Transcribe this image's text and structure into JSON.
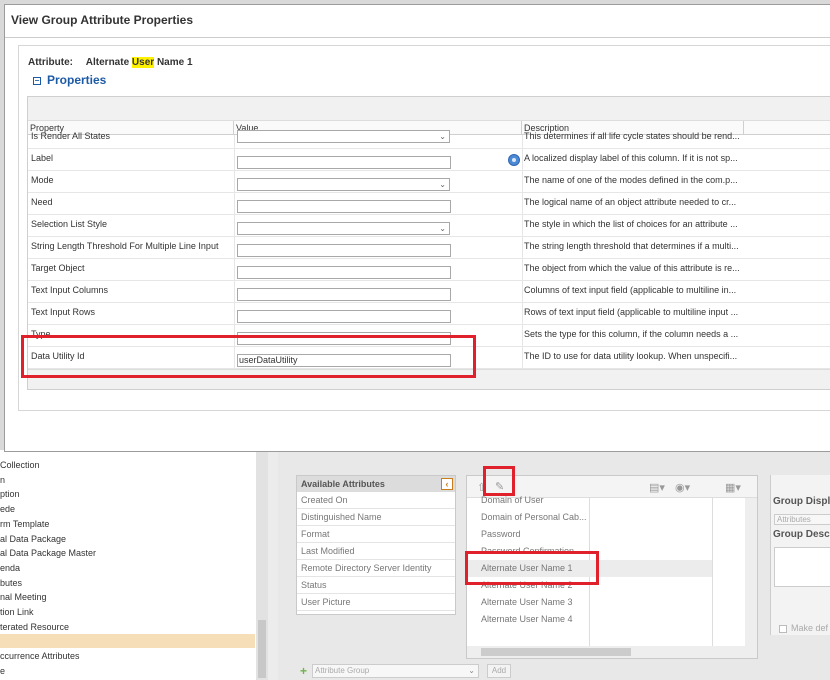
{
  "dialog": {
    "title": "View Group Attribute Properties",
    "attribute_label": "Attribute:",
    "attribute_value_prefix": "Alternate",
    "attribute_value_highlight": "User",
    "attribute_value_suffix": "Name 1",
    "section_title": "Properties"
  },
  "grid": {
    "columns": [
      "Property",
      "Value",
      "Description"
    ],
    "rows": [
      {
        "property": "Is Render All States",
        "control": "select",
        "value": "",
        "description": "This determines if all life cycle states should be rend..."
      },
      {
        "property": "Label",
        "control": "input",
        "value": "",
        "description": "A localized display label of this column. If it is not sp...",
        "icon": "localize-icon"
      },
      {
        "property": "Mode",
        "control": "select",
        "value": "",
        "description": "The name of one of the modes defined in the com.p..."
      },
      {
        "property": "Need",
        "control": "input",
        "value": "",
        "description": "The logical name of an object attribute needed to cr..."
      },
      {
        "property": "Selection List Style",
        "control": "select",
        "value": "",
        "description": "The style in which the list of choices for an attribute ..."
      },
      {
        "property": "String Length Threshold For Multiple Line Input",
        "control": "input",
        "value": "",
        "description": "The string length threshold that determines if a multi..."
      },
      {
        "property": "Target Object",
        "control": "input",
        "value": "",
        "description": "The object from which the value of this attribute is re..."
      },
      {
        "property": "Text Input Columns",
        "control": "input",
        "value": "",
        "description": "Columns of text input field (applicable to multiline in..."
      },
      {
        "property": "Text Input Rows",
        "control": "input",
        "value": "",
        "description": "Rows of text input field (applicable to multiline input ..."
      },
      {
        "property": "Type",
        "control": "input",
        "value": "",
        "description": "Sets the type for this column, if the column needs a ..."
      },
      {
        "property": "Data Utility Id",
        "control": "input",
        "value": "userDataUtility",
        "description": "The ID to use for data utility lookup. When unspecifi..."
      }
    ]
  },
  "background": {
    "tree_items": [
      "Collection",
      "n",
      "ption",
      "ede",
      "rm Template",
      "al Data Package",
      "al Data Package Master",
      "enda",
      "butes",
      "nal Meeting",
      "tion Link",
      "terated Resource",
      "",
      "ccurrence Attributes",
      "e"
    ],
    "available_attributes": {
      "title": "Available Attributes",
      "items": [
        "Created On",
        "Distinguished Name",
        "Format",
        "Last Modified",
        "Remote Directory Server Identity",
        "Status",
        "User Picture"
      ]
    },
    "member_attributes": {
      "items": [
        "Domain of User",
        "Domain of Personal Cab...",
        "Password",
        "Password Confirmation",
        "Alternate User Name 1",
        "Alternate User Name 2",
        "Alternate User Name 3",
        "Alternate User Name 4"
      ]
    },
    "group_panel": {
      "display_label": "Group Displa",
      "display_value": "Attributes",
      "description_label": "Group Descr",
      "checkbox_label": "Make def"
    },
    "attribute_group_placeholder": "Attribute Group",
    "add_label": "Add"
  },
  "colors": {
    "highlight_box": "#e0202a",
    "search_highlight": "#fff200",
    "section_blue": "#1d5aa5"
  }
}
